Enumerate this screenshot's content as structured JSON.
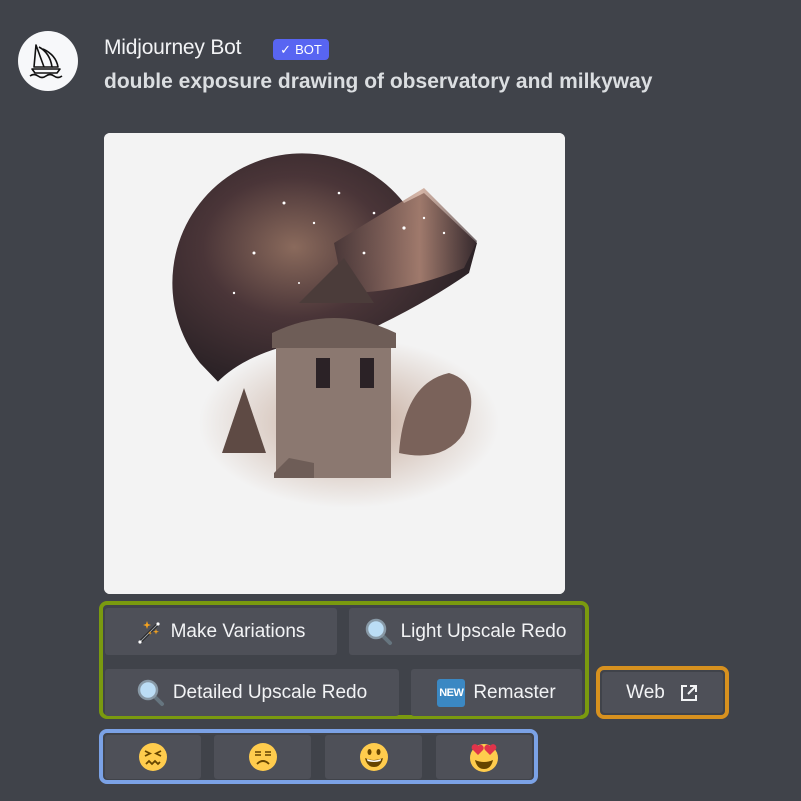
{
  "message": {
    "author": "Midjourney Bot",
    "badge": {
      "check": "✓",
      "label": "BOT",
      "color": "#5865f2"
    },
    "prompt": "double exposure drawing of observatory and milkyway",
    "image_alt": "double exposure drawing of observatory and milkyway"
  },
  "buttons": {
    "make_variations": {
      "label": "Make Variations",
      "icon": "magic-wand-icon"
    },
    "light_upscale_redo": {
      "label": "Light Upscale Redo",
      "icon": "magnifier-icon"
    },
    "detailed_upscale_redo": {
      "label": "Detailed Upscale Redo",
      "icon": "magnifier-icon"
    },
    "remaster": {
      "label": "Remaster",
      "icon": "new-icon",
      "icon_text": "NEW"
    },
    "web": {
      "label": "Web",
      "icon": "external-link-icon"
    }
  },
  "reactions": [
    {
      "name": "confounded",
      "icon": "confounded-face-icon"
    },
    {
      "name": "unamused",
      "icon": "unamused-face-icon"
    },
    {
      "name": "grinning",
      "icon": "grinning-face-icon"
    },
    {
      "name": "heart-eyes",
      "icon": "heart-eyes-face-icon"
    }
  ],
  "highlight_colors": {
    "green": "#7a9a0f",
    "orange": "#d7911f",
    "blue": "#7ba2e6"
  }
}
